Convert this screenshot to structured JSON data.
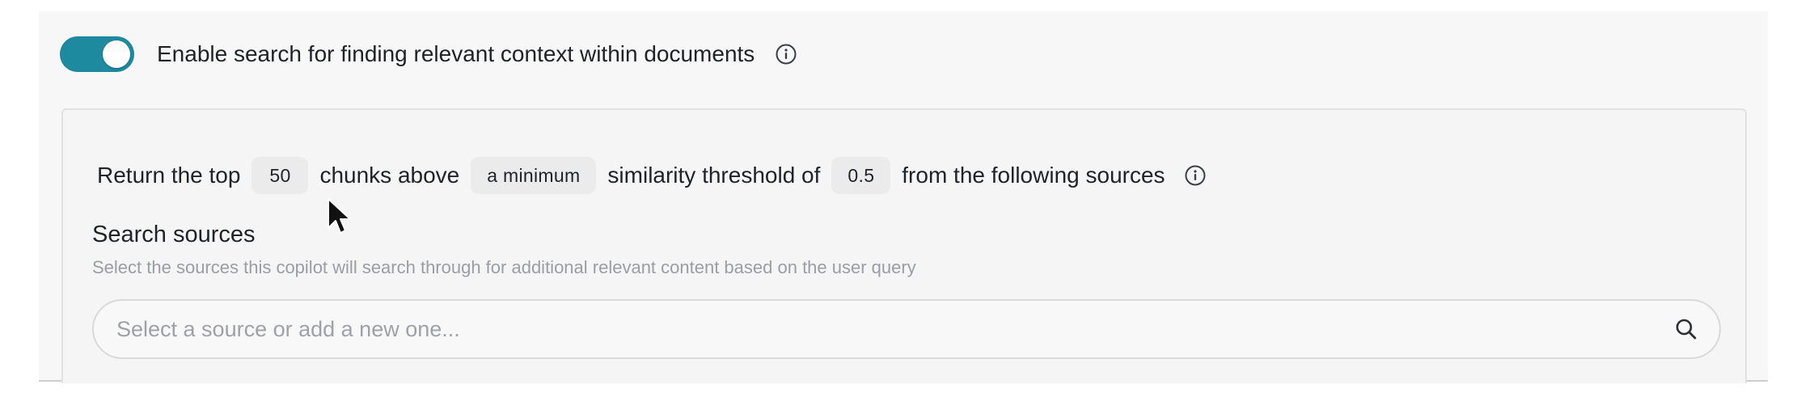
{
  "search_toggle": {
    "enabled": true,
    "label": "Enable search for finding relevant context within documents",
    "info_icon": "info-circle-icon",
    "accent_color": "#1e8aa0"
  },
  "retrieval": {
    "prefix": "Return the top",
    "top_k": "50",
    "middle": "chunks above",
    "threshold_mode": "a minimum",
    "middle2": "similarity threshold of",
    "threshold_value": "0.5",
    "suffix": "from the following sources",
    "info_icon": "info-circle-icon"
  },
  "sources": {
    "title": "Search sources",
    "help": "Select the sources this copilot will search through for additional relevant content based on the user query",
    "placeholder": "Select a source or add a new one...",
    "search_icon": "search-icon"
  }
}
